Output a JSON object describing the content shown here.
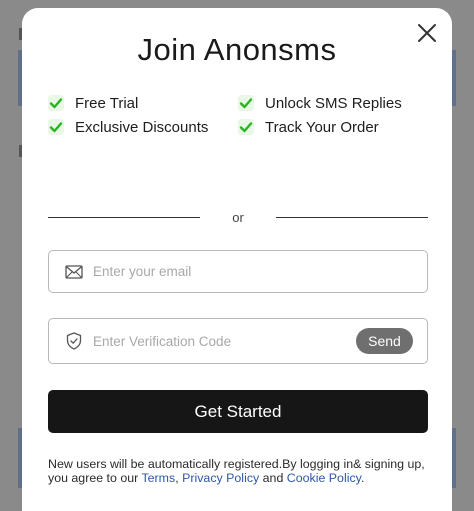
{
  "modal": {
    "title": "Join Anonsms",
    "benefits": [
      {
        "label": "Free Trial"
      },
      {
        "label": "Unlock SMS Replies"
      },
      {
        "label": "Exclusive Discounts"
      },
      {
        "label": "Track Your Order"
      }
    ],
    "divider_text": "or",
    "email": {
      "placeholder": "Enter your email",
      "value": ""
    },
    "code": {
      "placeholder": "Enter Verification Code",
      "value": "",
      "send_label": "Send"
    },
    "submit_label": "Get Started",
    "legal": {
      "text_before": "New users will be automatically registered.By logging in& signing up, you agree to our ",
      "terms": "Terms",
      "comma": ", ",
      "privacy": "Privacy Policy",
      "and": " and ",
      "cookie": "Cookie Policy",
      "end": "."
    }
  },
  "colors": {
    "overlay": "#8a8a8a",
    "check": "#2bb323",
    "primary": "#161616",
    "link": "#2e57a8",
    "send_button": "#6f6f6f"
  },
  "icons": {
    "close": "close-icon",
    "check": "check-icon",
    "email": "envelope-icon",
    "code": "shield-check-icon"
  }
}
